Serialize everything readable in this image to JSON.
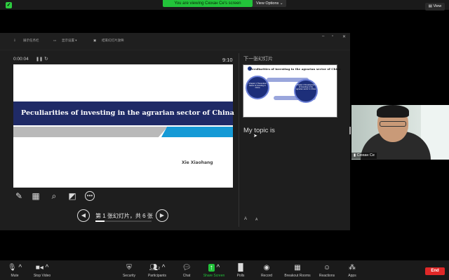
{
  "banner": {
    "viewing_text": "You are viewing Сюхан Се's screen",
    "view_options": "View Options ⌄",
    "view_button": "View"
  },
  "presenter": {
    "toolbar_items": [
      "展示任务栏",
      "显示设置 ▾",
      "结束幻灯片放映"
    ],
    "window_controls": [
      "–",
      "▫",
      "✕"
    ],
    "elapsed": "0:00:04",
    "clock": "9:10",
    "slide": {
      "title": "Peculiarities of investing in the agrarian sector of China",
      "author": "Xie Xiaohang"
    },
    "page_label": "第 1 张幻灯片，共 6 张",
    "next_label": "下一张幻灯片",
    "thumb": {
      "title": "Peculiarities of investing in the agrarian sector of China",
      "circle1": "Chapter 1 Theoretical bases of investing in China",
      "circle2": "Chapter 2 Development of investing in the agrarian sector in China"
    },
    "notes": "My topic is",
    "font_big": "A",
    "font_small": "A"
  },
  "video": {
    "name": "Сюхан Се"
  },
  "toolbar": {
    "mute": "Mute",
    "stop_video": "Stop Video",
    "security": "Security",
    "participants": "Participants",
    "participants_count": "2",
    "chat": "Chat",
    "share_screen": "Share Screen",
    "polls": "Polls",
    "record": "Record",
    "breakout": "Breakout Rooms",
    "reactions": "Reactions",
    "apps": "Apps",
    "end": "End"
  },
  "colors": {
    "accent_green": "#22c33a",
    "end_red": "#e02828",
    "slide_band": "#1f2a66",
    "slide_blue": "#159ad6"
  }
}
